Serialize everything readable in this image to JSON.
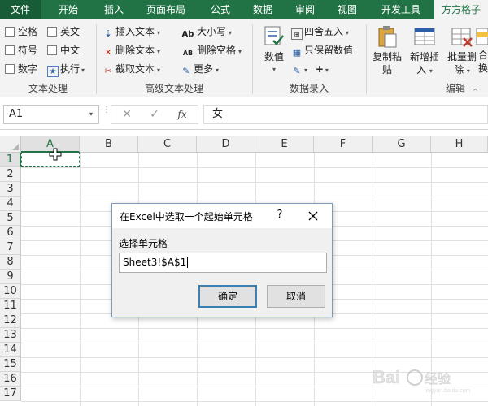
{
  "tabs": [
    {
      "label": "文件",
      "type": "file"
    },
    {
      "label": "开始"
    },
    {
      "label": "插入"
    },
    {
      "label": "页面布局"
    },
    {
      "label": "公式"
    },
    {
      "label": "数据"
    },
    {
      "label": "审阅"
    },
    {
      "label": "视图"
    },
    {
      "label": "开发工具"
    },
    {
      "label": "方方格子",
      "active": true
    }
  ],
  "ribbon": {
    "text_processing": {
      "checkboxes": [
        "空格",
        "英文",
        "符号",
        "中文",
        "数字"
      ],
      "execute": "执行",
      "group_label": "文本处理"
    },
    "advanced_text": {
      "insert_text": "插入文本",
      "delete_text": "删除文本",
      "extract_text": "截取文本",
      "case": "大小写",
      "delete_space": "删除空格",
      "more": "更多",
      "group_label": "高级文本处理"
    },
    "data_entry": {
      "value": "数值",
      "round": "四舍五入",
      "keep_value": "只保留数值",
      "group_label": "数据录入"
    },
    "edit": {
      "copy_paste": [
        "复制粘",
        "贴"
      ],
      "add_insert": [
        "新增插",
        "入"
      ],
      "batch_delete": [
        "批量删",
        "除"
      ],
      "merge": [
        "合",
        "换"
      ],
      "group_label": "编辑"
    }
  },
  "formula_bar": {
    "cell_ref": "A1",
    "fx": "fx",
    "content": "女"
  },
  "grid": {
    "columns": [
      "A",
      "B",
      "C",
      "D",
      "E",
      "F",
      "G",
      "H"
    ],
    "rows": [
      "1",
      "2",
      "3",
      "4",
      "5",
      "6",
      "7",
      "8",
      "9",
      "10",
      "11",
      "12",
      "13",
      "14",
      "15",
      "16",
      "17"
    ]
  },
  "dialog": {
    "title": "在Excel中选取一个起始单元格",
    "help": "?",
    "label": "选择单元格",
    "input_value": "Sheet3!$A$1",
    "ok": "确定",
    "cancel": "取消"
  },
  "colors": {
    "accent": "#217346",
    "file_tab": "#185c37",
    "ribbon_bg": "#f3f3f3",
    "dialog_bg": "#f0f0f0",
    "ok_border": "#3c7fb1"
  }
}
